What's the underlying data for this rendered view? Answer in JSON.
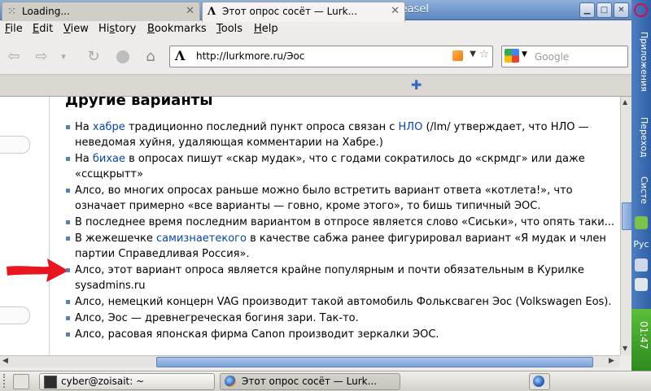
{
  "window": {
    "title": "Этот опрос сосёт — Lurkmore - Iceweasel",
    "controls": {
      "minimize": "▁",
      "maximize": "□",
      "close": "✕"
    }
  },
  "menu": {
    "items": [
      {
        "label": "File",
        "accel": "F",
        "rest": "ile"
      },
      {
        "label": "Edit",
        "accel": "E",
        "rest": "dit"
      },
      {
        "label": "View",
        "accel": "V",
        "rest": "iew"
      },
      {
        "label": "History",
        "accel": "s",
        "pre": "Hi",
        "rest": "tory"
      },
      {
        "label": "Bookmarks",
        "accel": "B",
        "rest": "ookmarks"
      },
      {
        "label": "Tools",
        "accel": "T",
        "rest": "ools"
      },
      {
        "label": "Help",
        "accel": "H",
        "rest": "elp"
      }
    ]
  },
  "toolbar": {
    "url": "http://lurkmore.ru/Эос",
    "site_icon": "Λ",
    "search_placeholder": "Google",
    "icons": [
      "back-icon",
      "forward-icon",
      "history-dropdown-icon",
      "reload-icon",
      "stop-icon",
      "home-icon"
    ]
  },
  "tabs": [
    {
      "label": "Loading...",
      "active": false
    },
    {
      "label": "Этот опрос сосёт — Lurk...",
      "active": true
    }
  ],
  "page": {
    "heading": "Другие варианты",
    "bullets": [
      {
        "parts": [
          "На ",
          "хабре",
          " традиционно последний пункт опроса связан с ",
          "НЛО",
          " (/lm/ утверждает, что НЛО — неведомая хуйня, удаляющая комментарии на Хабре.)"
        ]
      },
      {
        "parts": [
          "На ",
          "бихае",
          " в опросах пишут «скар мудак», что с годами сократилось до «скрмдг» или даже «ссщкрытт»"
        ]
      },
      {
        "text": "Алсо, во многих опросах раньше можно было встретить вариант ответа «котлета!», что означает примерно «все варианты — говно, кроме этого», то бишь типичный ЭОС."
      },
      {
        "text": "В последнее время последним вариантом в отпросе является слово «Сиськи», что опять таки..."
      },
      {
        "parts": [
          "В жежешечке ",
          "самизнаетекого",
          " в качестве сабжа ранее фигурировал вариант «Я мудак и член партии Справедливая Россия»."
        ]
      },
      {
        "text": "Алсо, этот вариант опроса является крайне популярным и почти обязательным в Курилке sysadmins.ru"
      },
      {
        "text": "Алсо, немецкий концерн VAG производит такой автомобиль Фольксваген Эос (Volkswagen Eos)."
      },
      {
        "text": "Алсо, Эос — древнегреческая богиня зари. Так-то."
      },
      {
        "text": "Алсо, расовая японская фирма Canon производит зеркалки ЭОС."
      }
    ]
  },
  "side_panel": {
    "apps": "Приложения",
    "go": "Переход",
    "system": "Систе",
    "lang": "Рус",
    "time": "01:47"
  },
  "taskbar": {
    "tasks": [
      {
        "label": "cyber@zoisait: ~"
      },
      {
        "label": "Этот опрос сосёт — Lurk..."
      }
    ]
  },
  "colors": {
    "link": "#0645ad",
    "panel_blue": "#2f5fa6",
    "arrow_red": "#e8141e"
  }
}
